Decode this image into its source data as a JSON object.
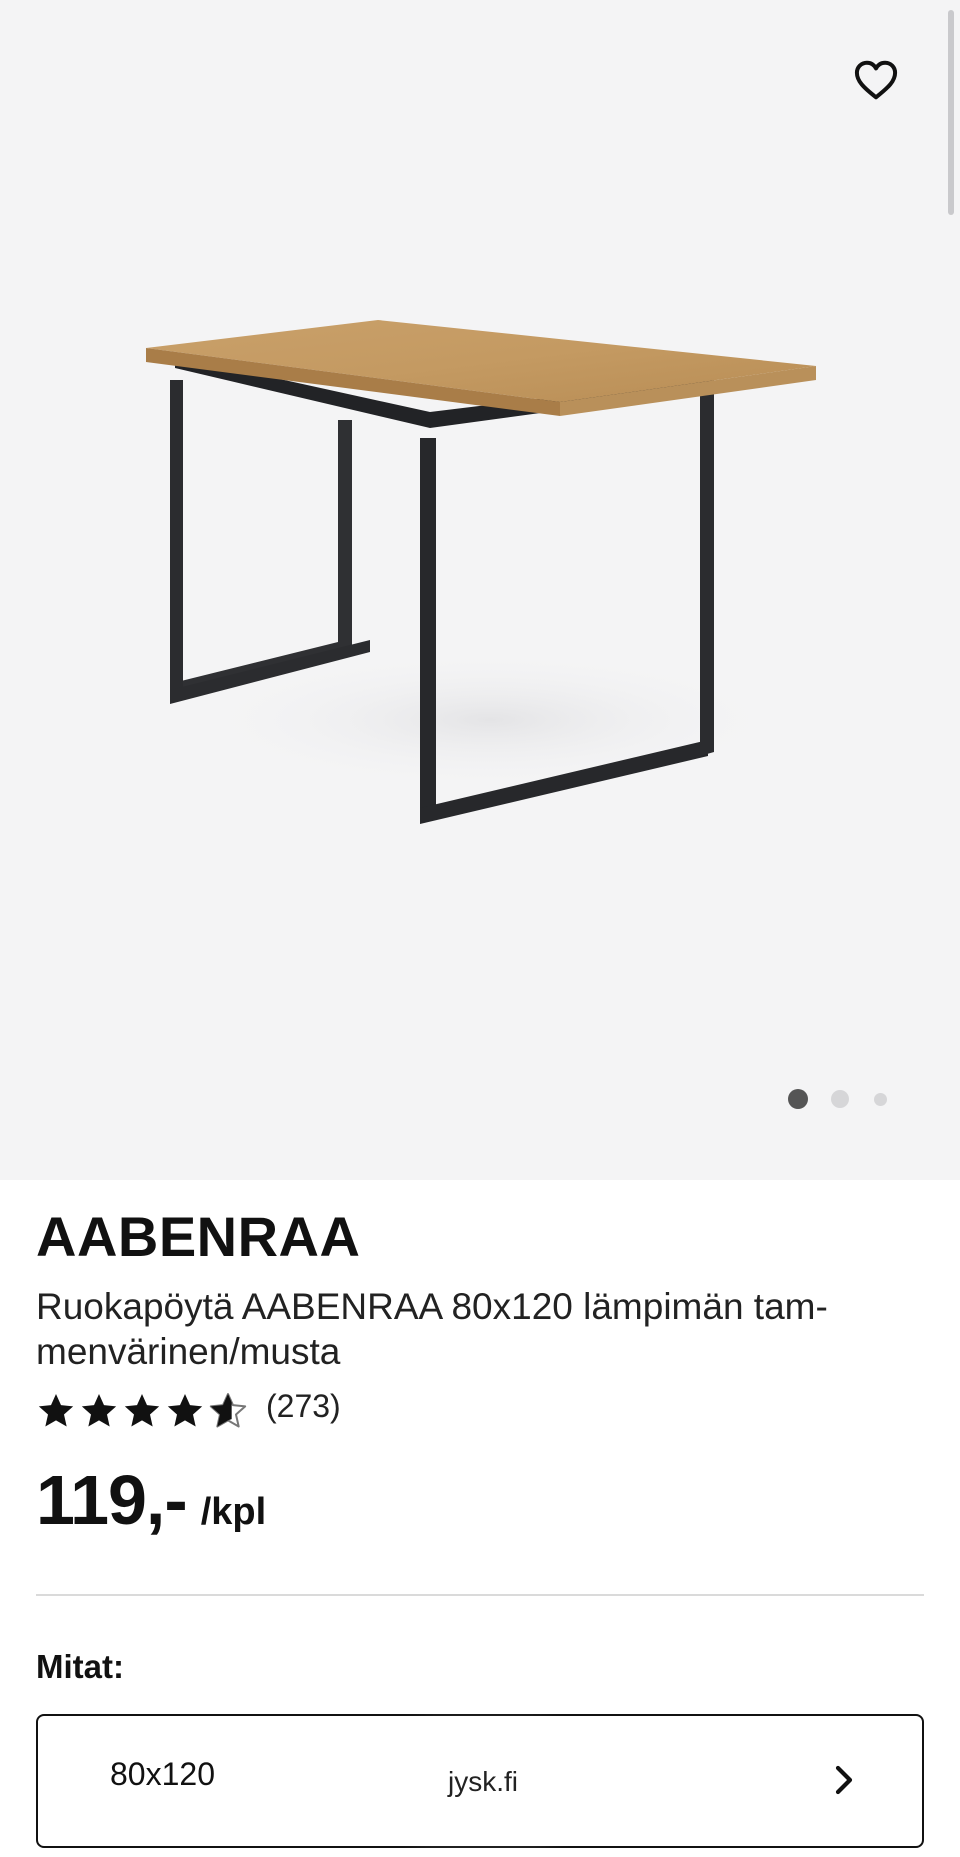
{
  "product": {
    "name": "AABENRAA",
    "description": "Ruokapöytä AABENRAA 80x120 lämpimän tam-menvärinen/musta",
    "rating_count": "(273)",
    "rating": 4.5,
    "price": "119,-",
    "unit": "/kpl"
  },
  "gallery": {
    "slide_count": 3,
    "active_slide": 1
  },
  "dimensions": {
    "label": "Mitat:",
    "selected": "80x120"
  },
  "browser": {
    "domain": "jysk.fi"
  },
  "icons": {
    "favorite": "heart-outline-icon",
    "rating": "star-icon",
    "select": "chevron-right-icon"
  },
  "colors": {
    "hero_background": "#f4f4f5",
    "text": "#111111",
    "active_dot": "#555555",
    "inactive_dot": "#d6d6d8",
    "divider": "#dadada"
  }
}
